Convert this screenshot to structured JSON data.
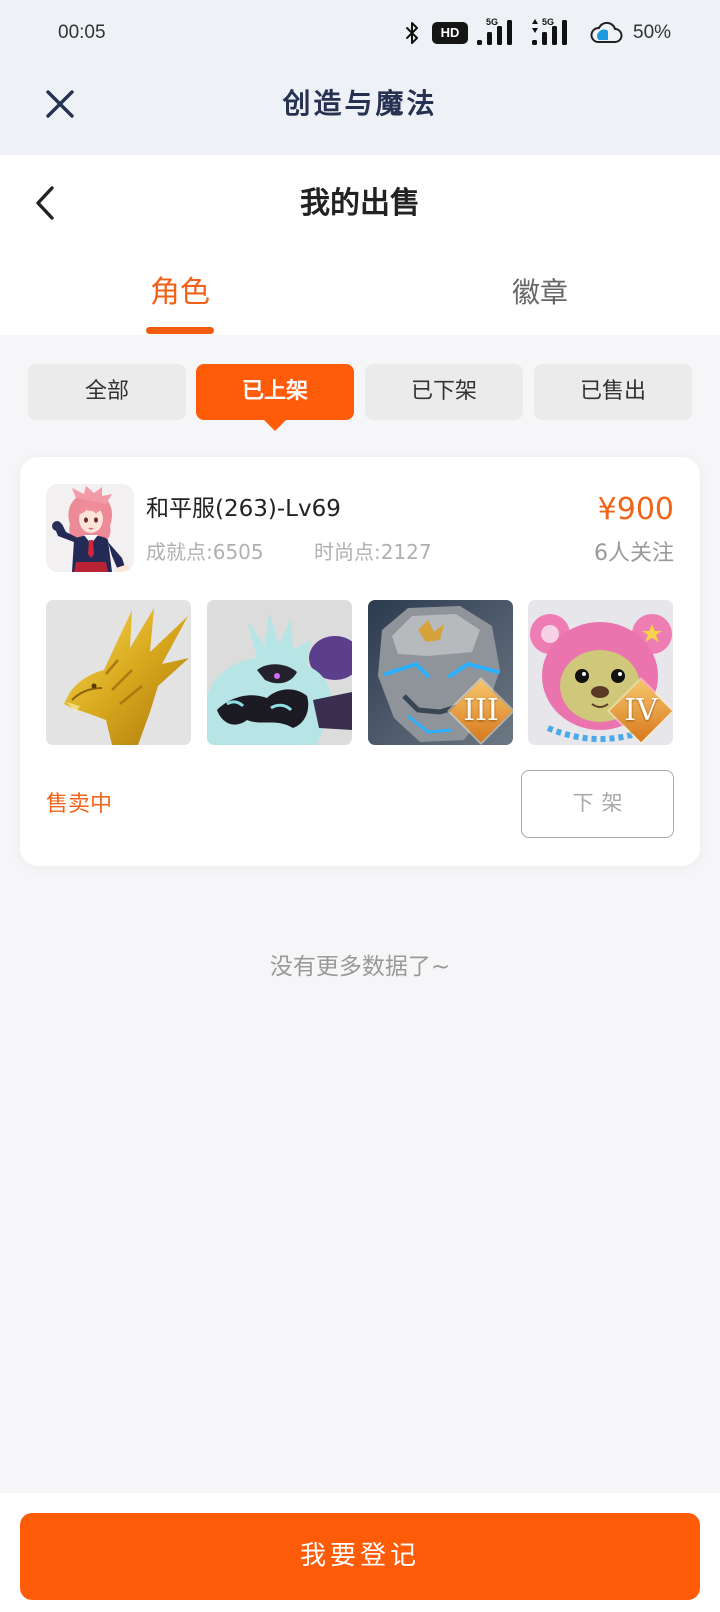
{
  "status_bar": {
    "time": "00:05",
    "hd_label": "HD",
    "network_1": "5G",
    "network_2": "5G",
    "battery": "50%",
    "icons": [
      "bluetooth-icon",
      "hd-icon",
      "signal-icon",
      "signal-icon",
      "cloud-icon"
    ]
  },
  "app_bar": {
    "title": "创造与魔法",
    "close_icon": "close-icon"
  },
  "page_header": {
    "title": "我的出售",
    "back_icon": "chevron-left-icon"
  },
  "tabs": [
    {
      "label": "角色",
      "active": true
    },
    {
      "label": "徽章",
      "active": false
    }
  ],
  "filters": [
    {
      "label": "全部",
      "active": false
    },
    {
      "label": "已上架",
      "active": true
    },
    {
      "label": "已下架",
      "active": false
    },
    {
      "label": "已售出",
      "active": false
    }
  ],
  "listings": [
    {
      "name": "和平服(263)-Lv69",
      "achievement": "成就点:6505",
      "fashion": "时尚点:2127",
      "price": "¥900",
      "followers": "6人关注",
      "status": "售卖中",
      "action_label": "下架",
      "items": [
        {},
        {},
        {
          "badge": "III"
        },
        {
          "badge": "IV"
        }
      ]
    }
  ],
  "footer_note": "没有更多数据了~",
  "primary_button": "我要登记",
  "colors": {
    "accent": "#ff5c0a",
    "accent_text": "#f0651a",
    "header_bg": "#eef2f6",
    "page_bg": "#f6f6f8",
    "chip_bg": "#ebebeb",
    "title_navy": "#273152"
  }
}
